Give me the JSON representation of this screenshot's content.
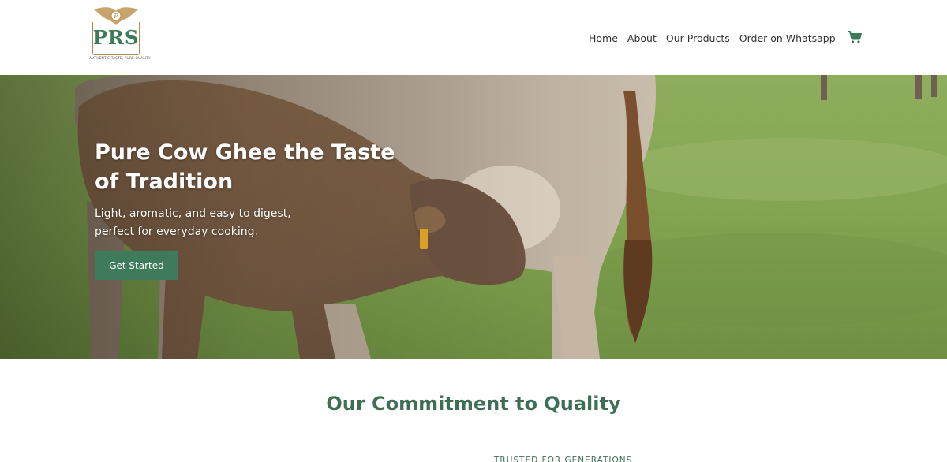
{
  "header": {
    "logo": {
      "brand": "PRS",
      "tagline": "AUTHENTIC TASTE, PURE QUALITY"
    },
    "nav": [
      {
        "label": "Home"
      },
      {
        "label": "About"
      },
      {
        "label": "Our Products"
      },
      {
        "label": "Order on Whatsapp"
      }
    ],
    "cart_icon": "shopping-cart-icon"
  },
  "hero": {
    "title": "Pure Cow Ghee the Taste of Tradition",
    "subtitle": "Light, aromatic, and easy to digest, perfect for everyday cooking.",
    "cta_label": "Get Started"
  },
  "commitment": {
    "title": "Our Commitment to Quality",
    "eyebrow": "TRUSTED FOR GENERATIONS"
  },
  "colors": {
    "brand_green": "#3e7b5a",
    "heading_green": "#3e6f55",
    "logo_gold": "#b08850"
  }
}
